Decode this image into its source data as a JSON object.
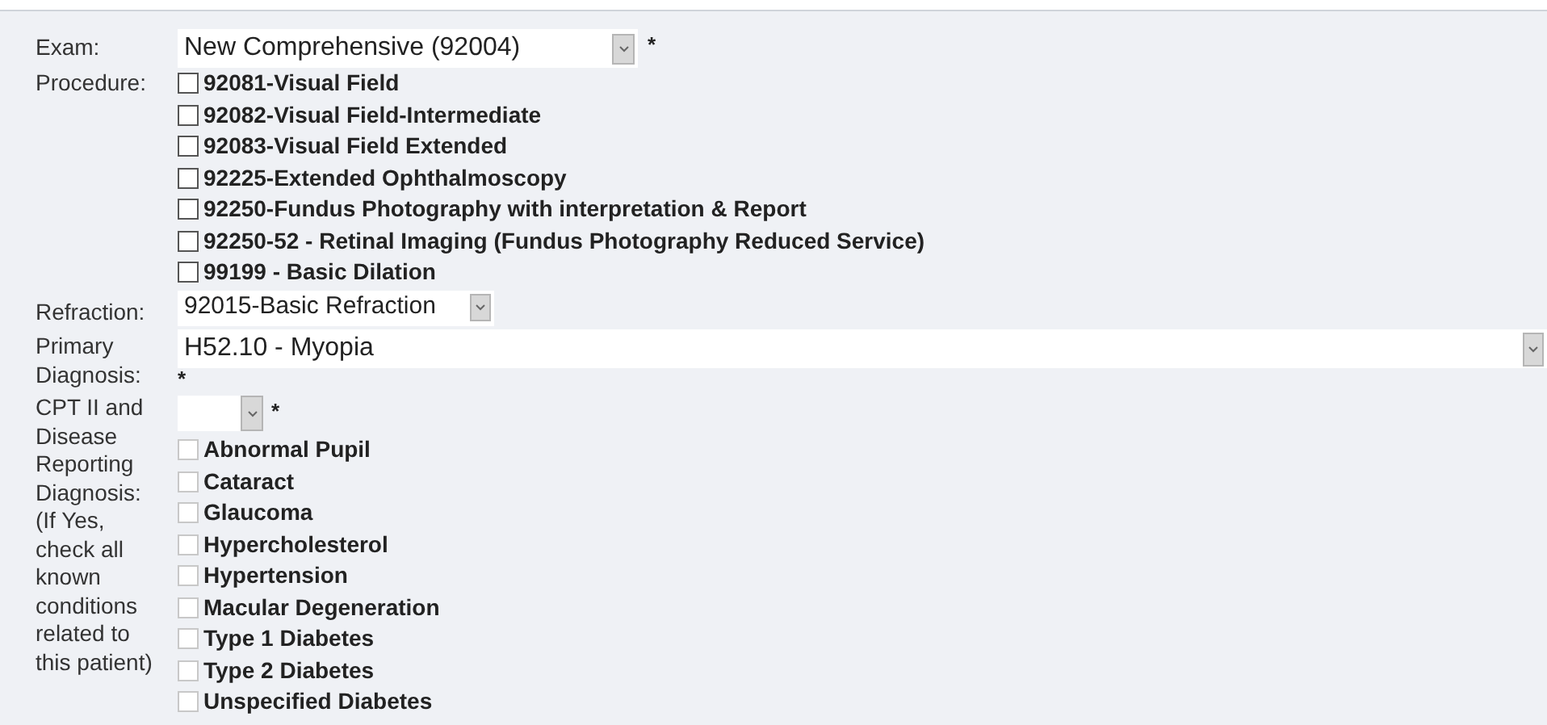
{
  "exam": {
    "label": "Exam:",
    "value": "New Comprehensive (92004)",
    "required_mark": "*"
  },
  "procedure": {
    "label": "Procedure:",
    "options": [
      {
        "label": "92081-Visual Field",
        "checked": false
      },
      {
        "label": "92082-Visual Field-Intermediate",
        "checked": false
      },
      {
        "label": "92083-Visual Field Extended",
        "checked": false
      },
      {
        "label": "92225-Extended Ophthalmoscopy",
        "checked": false
      },
      {
        "label": "92250-Fundus Photography with interpretation & Report",
        "checked": false
      },
      {
        "label": "92250-52 - Retinal Imaging (Fundus Photography Reduced Service)",
        "checked": false
      },
      {
        "label": "99199 - Basic Dilation",
        "checked": false
      }
    ]
  },
  "refraction": {
    "label": "Refraction:",
    "value": "92015-Basic Refraction"
  },
  "primary_diagnosis": {
    "label": "Primary Diagnosis:",
    "value": "H52.10 - Myopia",
    "required_mark": "*"
  },
  "cpt_ii": {
    "label": "CPT II and Disease Reporting Diagnosis: (If Yes, check all known conditions related to this patient)",
    "required_mark": "*",
    "conditions": [
      {
        "label": "Abnormal Pupil",
        "checked": false
      },
      {
        "label": "Cataract",
        "checked": false
      },
      {
        "label": "Glaucoma",
        "checked": false
      },
      {
        "label": "Hypercholesterol",
        "checked": false
      },
      {
        "label": "Hypertension",
        "checked": false
      },
      {
        "label": "Macular Degeneration",
        "checked": false
      },
      {
        "label": "Type 1 Diabetes",
        "checked": false
      },
      {
        "label": "Type 2 Diabetes",
        "checked": false
      },
      {
        "label": "Unspecified Diabetes",
        "checked": false
      }
    ]
  }
}
